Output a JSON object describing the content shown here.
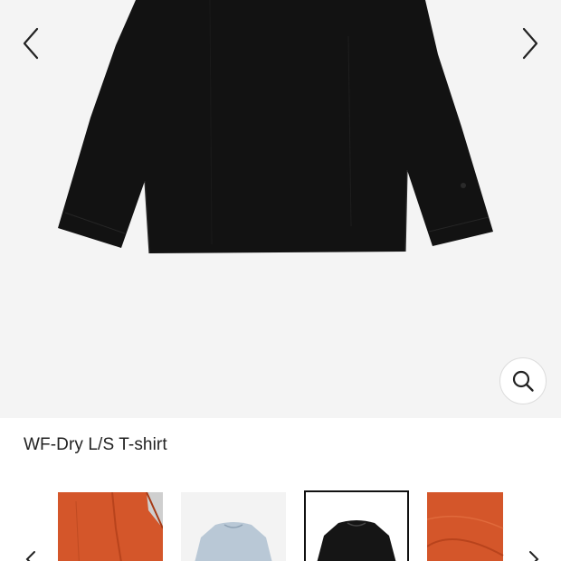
{
  "product": {
    "title": "WF-Dry L/S T-shirt"
  },
  "gallery": {
    "background_color": "#f4f4f4",
    "main_image": "black long-sleeve t-shirt",
    "prev_icon": "chevron-left-icon",
    "next_icon": "chevron-right-icon",
    "zoom_icon": "magnifier-icon"
  },
  "thumbnails": [
    {
      "alt": "orange t-shirt detail",
      "color": "#d4562a",
      "selected": false
    },
    {
      "alt": "light blue long-sleeve t-shirt",
      "color": "#b9c8d6",
      "selected": false
    },
    {
      "alt": "black long-sleeve t-shirt",
      "color": "#151515",
      "selected": true
    },
    {
      "alt": "orange fabric close-up",
      "color": "#d4562a",
      "selected": false
    }
  ],
  "thumbnail_strip": {
    "prev_icon": "chevron-left-icon",
    "next_icon": "chevron-right-icon"
  }
}
